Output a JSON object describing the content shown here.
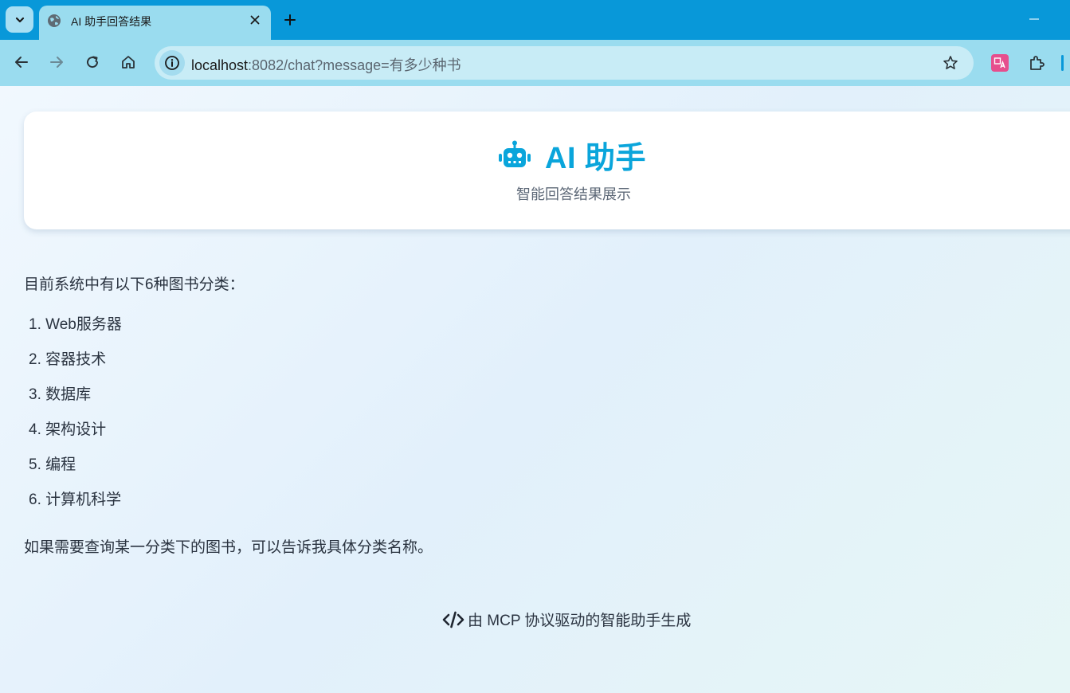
{
  "browser": {
    "tab": {
      "title": "AI 助手回答结果"
    },
    "url": {
      "host": "localhost",
      "rest": ":8082/chat?message=有多少种书"
    }
  },
  "icons": {
    "tab_menu": "chevron-down-icon",
    "favicon": "globe-icon",
    "tab_close": "close-icon",
    "new_tab": "plus-icon",
    "minimize": "minimize-icon",
    "back": "arrow-left-icon",
    "forward": "arrow-right-icon",
    "reload": "reload-icon",
    "home": "home-icon",
    "site_info": "info-icon",
    "bookmark": "star-icon",
    "translate": "translate-icon",
    "extensions": "puzzle-icon",
    "robot": "robot-icon",
    "code": "code-icon"
  },
  "colors": {
    "tab_strip": "#0898d9",
    "toolbar": "#9adcef",
    "accent": "#0aa5db"
  },
  "header": {
    "title": "AI 助手",
    "subtitle": "智能回答结果展示"
  },
  "answer": {
    "intro": "目前系统中有以下6种图书分类：",
    "categories": [
      "1. Web服务器",
      "2. 容器技术",
      "3. 数据库",
      "4. 架构设计",
      "5. 编程",
      "6. 计算机科学"
    ],
    "outro": "如果需要查询某一分类下的图书，可以告诉我具体分类名称。"
  },
  "footer": {
    "text": "由 MCP 协议驱动的智能助手生成"
  }
}
